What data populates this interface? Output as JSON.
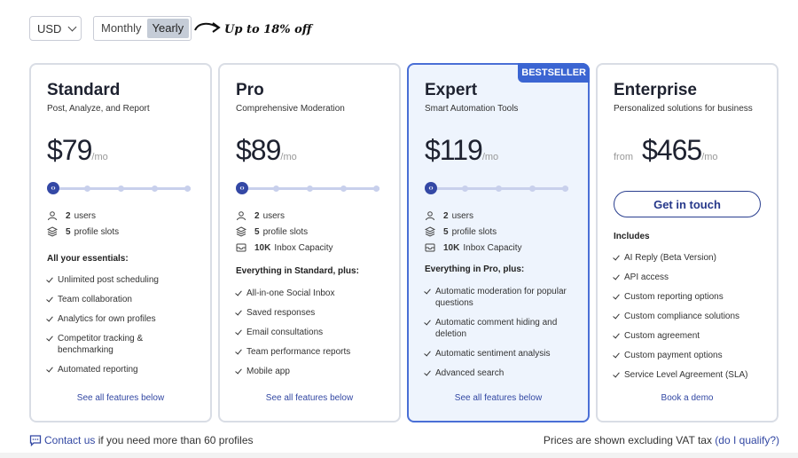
{
  "currency": {
    "selected": "USD"
  },
  "billing": {
    "monthly": "Monthly",
    "yearly": "Yearly",
    "selected": "Yearly"
  },
  "promo": "Up to 18% off",
  "plans": [
    {
      "name": "Standard",
      "subtitle": "Post, Analyze, and Report",
      "price": "$79",
      "per": "/mo",
      "stats": {
        "users_count": "2",
        "users_label": "users",
        "slots_count": "5",
        "slots_label": "profile slots"
      },
      "features_title": "All your essentials:",
      "features": [
        "Unlimited post scheduling",
        "Team collaboration",
        "Analytics for own profiles",
        "Competitor tracking & benchmarking",
        "Automated reporting"
      ],
      "see_all": "See all features below"
    },
    {
      "name": "Pro",
      "subtitle": "Comprehensive Moderation",
      "price": "$89",
      "per": "/mo",
      "stats": {
        "users_count": "2",
        "users_label": "users",
        "slots_count": "5",
        "slots_label": "profile slots",
        "inbox_count": "10K",
        "inbox_label": "Inbox Capacity"
      },
      "features_title": "Everything in Standard, plus:",
      "features": [
        "All-in-one Social Inbox",
        "Saved responses",
        "Email consultations",
        "Team performance reports",
        "Mobile app"
      ],
      "see_all": "See all features below"
    },
    {
      "name": "Expert",
      "subtitle": "Smart Automation Tools",
      "price": "$119",
      "per": "/mo",
      "badge": "BESTSELLER",
      "stats": {
        "users_count": "2",
        "users_label": "users",
        "slots_count": "5",
        "slots_label": "profile slots",
        "inbox_count": "10K",
        "inbox_label": "Inbox Capacity"
      },
      "features_title": "Everything in Pro, plus:",
      "features": [
        "Automatic moderation for popular questions",
        "Automatic comment hiding and deletion",
        "Automatic sentiment analysis",
        "Advanced search"
      ],
      "see_all": "See all features below"
    },
    {
      "name": "Enterprise",
      "subtitle": "Personalized solutions for business",
      "price_prefix": "from",
      "price": "$465",
      "per": "/mo",
      "cta": "Get in touch",
      "features_title": "Includes",
      "features": [
        "AI Reply (Beta Version)",
        "API access",
        "Custom reporting options",
        "Custom compliance solutions",
        "Custom agreement",
        "Custom payment options",
        "Service Level Agreement (SLA)"
      ],
      "see_all": "Book a demo"
    }
  ],
  "footer": {
    "contact_link": "Contact us",
    "contact_text": "if you need more than 60 profiles",
    "vat_text": "Prices are shown excluding VAT tax",
    "qualify_link": "(do I qualify?)"
  },
  "colors": {
    "accent": "#3b65d2",
    "link": "#3348a3",
    "featured_bg": "#eef4fd"
  }
}
